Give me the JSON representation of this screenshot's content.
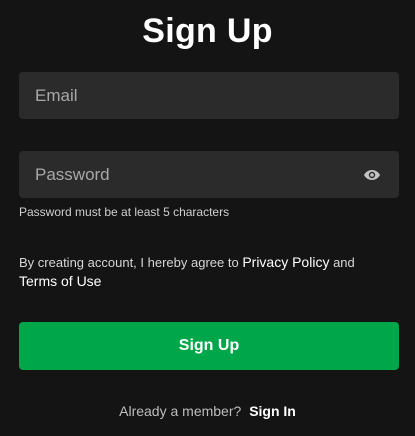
{
  "page": {
    "title": "Sign Up"
  },
  "form": {
    "email": {
      "placeholder": "Email",
      "value": ""
    },
    "password": {
      "placeholder": "Password",
      "value": "",
      "toggle_icon": "eye-icon",
      "hint": "Password must be at least 5 characters"
    },
    "agreement": {
      "prefix": "By creating account, I hereby agree to ",
      "privacy_link": "Privacy Policy",
      "conjunction": " and",
      "terms_link": "Terms of Use"
    },
    "submit_label": "Sign Up"
  },
  "footer": {
    "prompt": "Already a member?",
    "signin_link": "Sign In"
  },
  "colors": {
    "background": "#141414",
    "field_background": "#2b2b2b",
    "primary_button": "#00a64a",
    "text": "#ffffff"
  }
}
